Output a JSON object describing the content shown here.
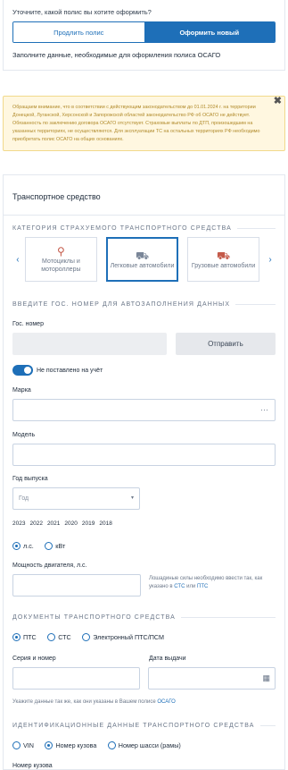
{
  "policy_choice": {
    "question": "Уточните, какой полис вы хотите оформить?",
    "extend_label": "Продлить полис",
    "new_label": "Оформить новый",
    "fill_note": "Заполните данные, необходимые для оформления полиса ОСАГО"
  },
  "notice": {
    "text": "Обращаем внимание, что в соответствии с действующим законодательством до 01.01.2024 г. на территории Донецкой, Луганской, Херсонской и Запорожской областей законодательство РФ об ОСАГО не действует. Обязанность по заключению договора ОСАГО отсутствует. Страховые выплаты по ДТП, произошедшим на указанных территориях, не осуществляются. Для эксплуатации ТС на остальных территориях РФ необходимо приобретать полис ОСАГО на общих основаниях.",
    "close_glyph": "✖"
  },
  "vehicle": {
    "section_title": "Транспортное средство",
    "category_heading": "Категория страхуемого транспортного средства",
    "categories": [
      {
        "label": "Мотоциклы и мотороллеры",
        "icon": "motorcycle-icon"
      },
      {
        "label": "Легковые автомобили",
        "icon": "car-icon"
      },
      {
        "label": "Грузовые автомобили",
        "icon": "truck-icon"
      }
    ],
    "plate_heading": "Введите гос. номер для автозаполнения данных",
    "plate_label": "Гос. номер",
    "send_button": "Отправить",
    "not_registered_label": "Не поставлено на учёт",
    "brand_label": "Марка",
    "brand_more": "···",
    "model_label": "Модель",
    "year_label": "Год выпуска",
    "year_placeholder": "Год",
    "year_quick": [
      "2023",
      "2022",
      "2021",
      "2020",
      "2019",
      "2018"
    ],
    "power_units": [
      "л.с.",
      "кВт"
    ],
    "power_label": "Мощность двигателя, л.с.",
    "power_hint_prefix": "Лошадиные силы необходимо ввести так, как указано в",
    "power_hint_sts": "СТС",
    "power_hint_or": "или",
    "power_hint_pts": "ПТС"
  },
  "documents": {
    "heading": "Документы транспортного средства",
    "doc_types": [
      "ПТС",
      "СТС",
      "Электронный ПТС/ПСМ"
    ],
    "series_label": "Серия и номер",
    "date_label": "Дата выдачи",
    "hint_prefix": "Укажите данные так же, как они указаны в Вашем полисе",
    "hint_link": "ОСАГО"
  },
  "identification": {
    "heading": "Идентификационные данные транспортного средства",
    "id_types": [
      "VIN",
      "Номер кузова",
      "Номер шасси (рамы)"
    ],
    "body_number_label": "Номер кузова"
  }
}
